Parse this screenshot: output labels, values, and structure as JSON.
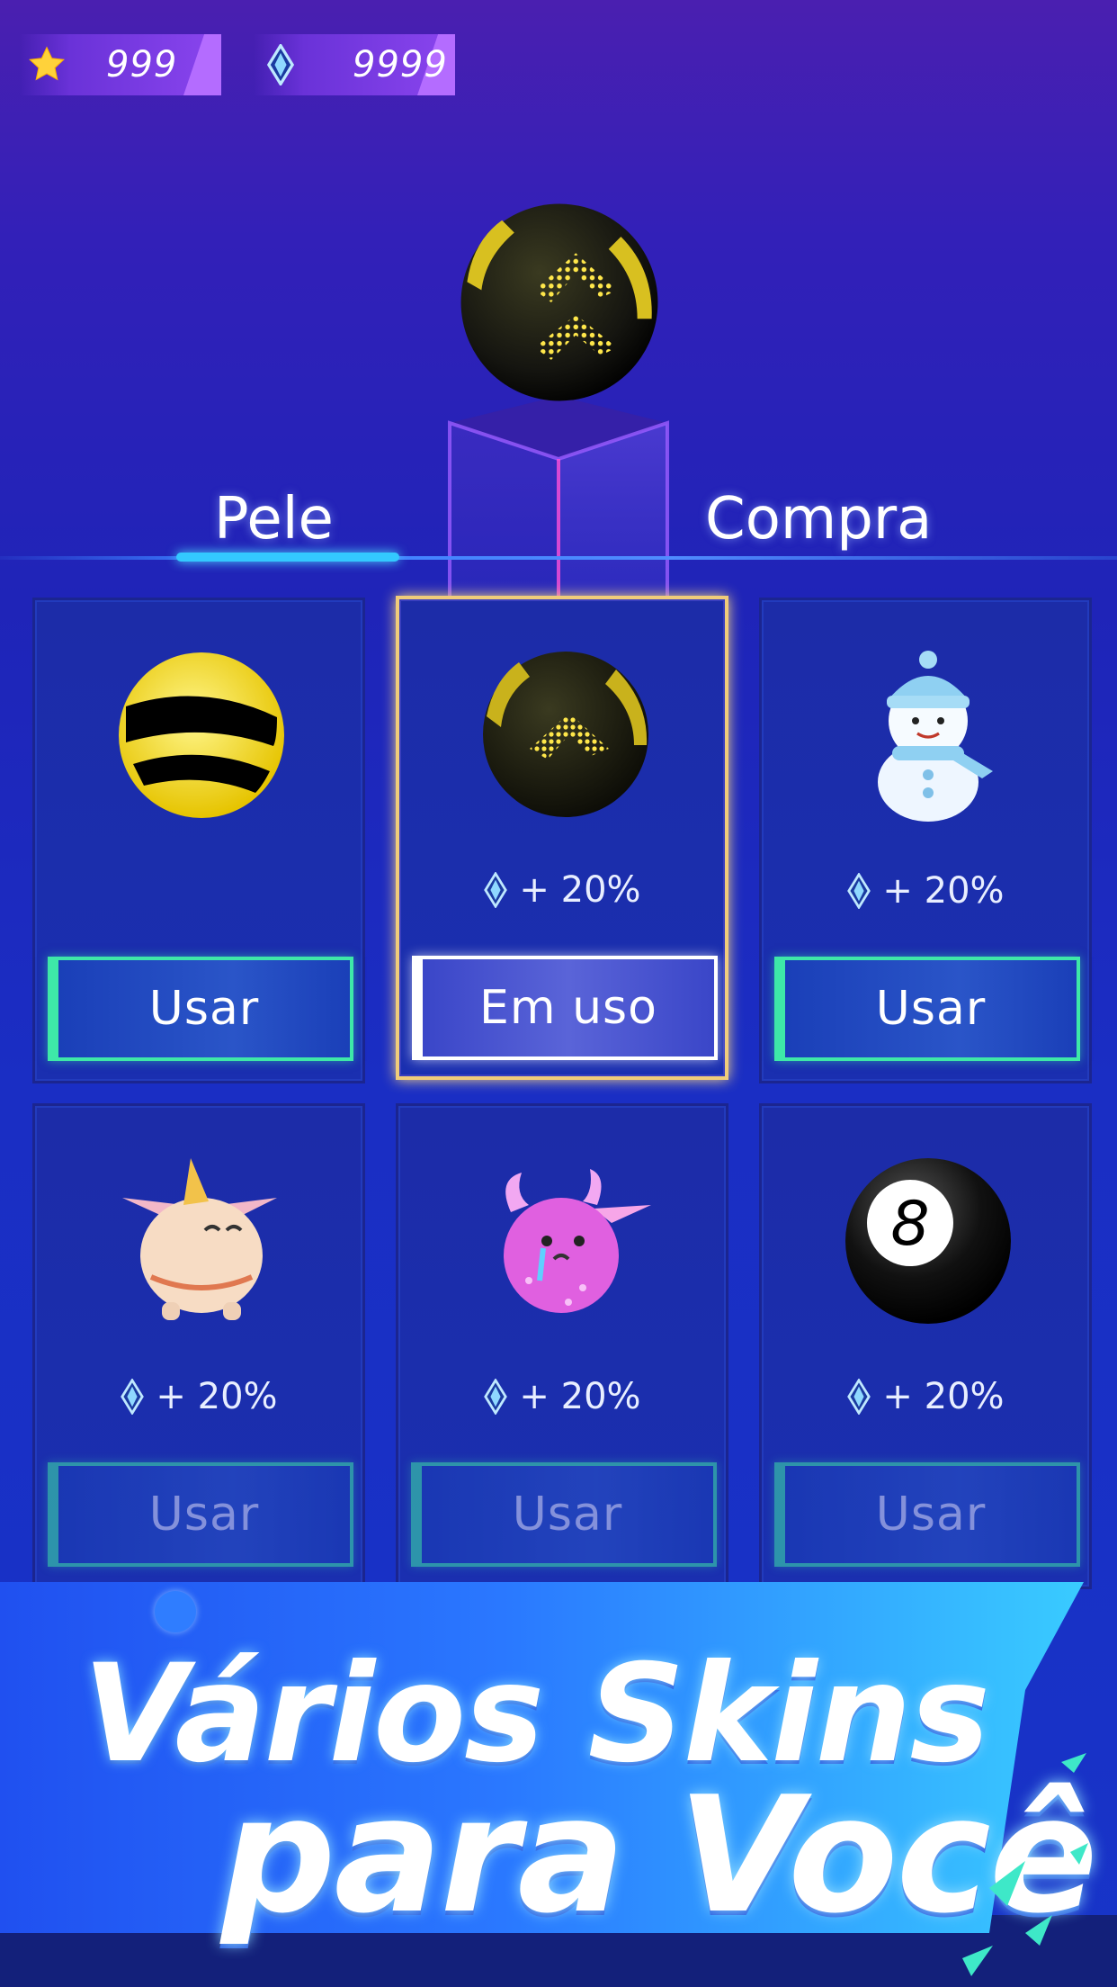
{
  "currency": {
    "stars": {
      "icon": "star-icon",
      "value": "999"
    },
    "gems": {
      "icon": "diamond-icon",
      "value": "9999"
    }
  },
  "tabs": [
    {
      "label": "Pele",
      "active": true
    },
    {
      "label": "Compra",
      "active": false
    }
  ],
  "skins": [
    {
      "name": "yellow-stripe-ball",
      "bonus": "",
      "button": "Usar",
      "state": "available"
    },
    {
      "name": "hex-chevron-ball",
      "bonus": "+ 20%",
      "button": "Em uso",
      "state": "in-use"
    },
    {
      "name": "snowman",
      "bonus": "+ 20%",
      "button": "Usar",
      "state": "available"
    },
    {
      "name": "cream-horned-monster",
      "bonus": "+ 20%",
      "button": "Usar",
      "state": "dim"
    },
    {
      "name": "pink-crying-monster",
      "bonus": "+ 20%",
      "button": "Usar",
      "state": "dim"
    },
    {
      "name": "eight-ball",
      "bonus": "+ 20%",
      "button": "Usar",
      "state": "dim"
    }
  ],
  "promo": {
    "line1": "Vários Skins",
    "line2": "para Você"
  },
  "colors": {
    "button_border": "#3ee8a8",
    "selected_border": "#f0cc7a",
    "tab_underline": "#33c9ff"
  }
}
